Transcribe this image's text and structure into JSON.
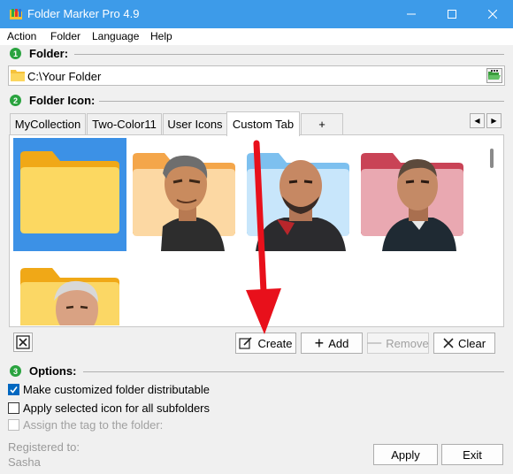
{
  "window": {
    "title": "Folder Marker Pro 4.9",
    "controls": [
      "minimize",
      "maximize",
      "close"
    ]
  },
  "menu": [
    "Action",
    "Folder",
    "Language",
    "Help"
  ],
  "folder_section": {
    "badge": "1",
    "title": "Folder:",
    "path": "C:\\Your Folder"
  },
  "icon_section": {
    "badge": "2",
    "title": "Folder Icon:",
    "tabs": [
      "MyCollection",
      "Two-Color11",
      "User Icons",
      "Custom Tab",
      "+"
    ],
    "active_tab": "Custom Tab",
    "icons": [
      {
        "name": "plain yellow folder",
        "color": "#f9c93a",
        "selected": true
      },
      {
        "name": "orange folder with portrait",
        "color": "#f6b24e"
      },
      {
        "name": "blue folder with portrait",
        "color": "#8ccbf4"
      },
      {
        "name": "red folder with portrait",
        "color": "#d5576a"
      },
      {
        "name": "yellow folder with portrait",
        "color": "#f9c93a"
      }
    ],
    "buttons": {
      "create": "Create",
      "add": "Add",
      "remove": "Remove",
      "clear": "Clear"
    }
  },
  "options_section": {
    "badge": "3",
    "title": "Options:",
    "items": [
      {
        "label": "Make customized folder distributable",
        "checked": true,
        "disabled": false
      },
      {
        "label": "Apply selected icon for all subfolders",
        "checked": false,
        "disabled": false
      },
      {
        "label": "Assign the tag to the folder:",
        "checked": false,
        "disabled": true
      }
    ]
  },
  "registration": {
    "label": "Registered to:",
    "user": "Sasha"
  },
  "footer": {
    "apply": "Apply",
    "exit": "Exit"
  },
  "colors": {
    "titlebar": "#3d9be9",
    "accent": "#0067c0",
    "badge": "#2aa33f",
    "arrow": "#e8101b"
  }
}
